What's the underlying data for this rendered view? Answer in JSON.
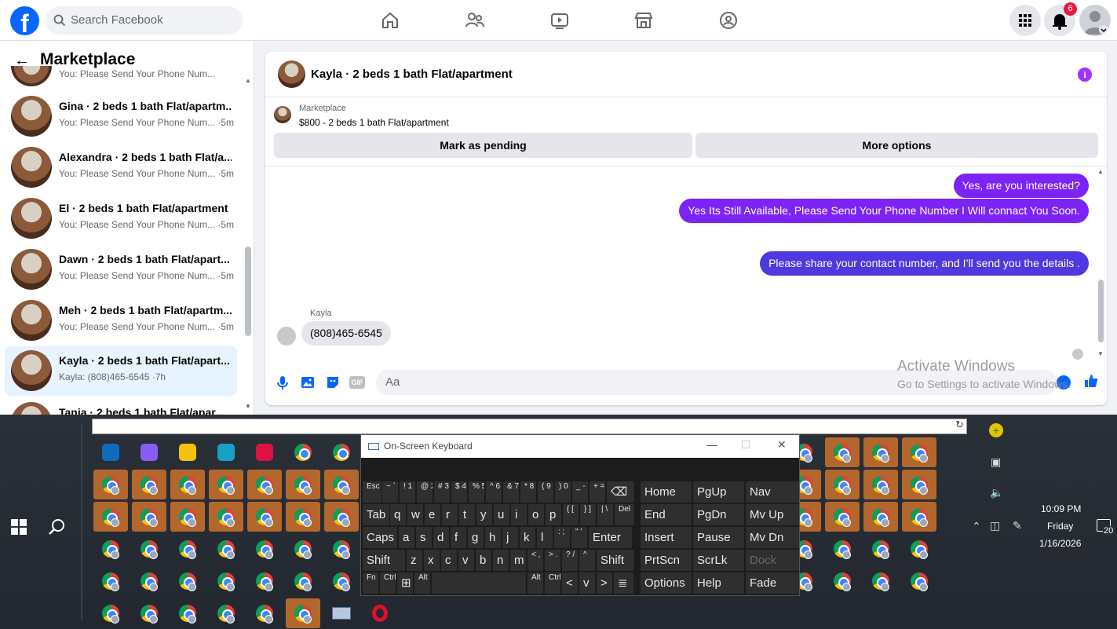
{
  "topnav": {
    "logo": "f",
    "search_placeholder": "Search Facebook",
    "notification_count": "6"
  },
  "sidebar": {
    "title": "Marketplace",
    "partial_top_text": "You: Please Send Your Phone Num...",
    "conversations": [
      {
        "title": "Gina · 2 beds 1 bath Flat/apartm...",
        "preview": "You: Please Send Your Phone Num... ·5m"
      },
      {
        "title": "Alexandra · 2 beds 1 bath Flat/a...",
        "preview": "You: Please Send Your Phone Num... ·5m"
      },
      {
        "title": "El · 2 beds 1 bath Flat/apartment",
        "preview": "You: Please Send Your Phone Num... ·5m"
      },
      {
        "title": "Dawn · 2 beds 1 bath Flat/apart...",
        "preview": "You: Please Send Your Phone Num... ·5m"
      },
      {
        "title": "Meh · 2 beds 1 bath Flat/apartm...",
        "preview": "You: Please Send Your Phone Num... ·5m"
      },
      {
        "title": "Kayla · 2 beds 1 bath Flat/apart...",
        "preview": "Kayla: (808)465-6545 ·7h"
      },
      {
        "title": "Tania · 2 beds 1 bath Flat/apar...",
        "preview": ""
      }
    ]
  },
  "chat": {
    "header_title": "Kayla · 2 beds 1 bath Flat/apartment",
    "marketplace_label": "Marketplace",
    "listing": "$800 - 2 beds 1 bath Flat/apartment",
    "mark_pending": "Mark as pending",
    "more_options": "More options",
    "messages_out": [
      "Yes, are you interested?",
      "Yes Its Still Available, Please Send Your Phone Number I Will connact You Soon.",
      "Please share your contact number, and I’ll send you the details ."
    ],
    "sender_name": "Kayla",
    "message_in": "(808)465-6545",
    "composer_placeholder": "Aa",
    "gif_label": "GIF"
  },
  "watermark": {
    "line1": "Activate Windows",
    "line2": "Go to Settings to activate Windows."
  },
  "osk": {
    "title": "On-Screen Keyboard",
    "row1": [
      "Esc",
      "~ `",
      "! 1",
      "@ 2",
      "# 3",
      "$ 4",
      "% 5",
      "^ 6",
      "& 7",
      "* 8",
      "( 9",
      ") 0",
      "_ -",
      "+ =",
      "⌫",
      "Home",
      "PgUp",
      "Nav"
    ],
    "row2": [
      "Tab",
      "q",
      "w",
      "e",
      "r",
      "t",
      "y",
      "u",
      "i",
      "o",
      "p",
      "{ [",
      "} ]",
      "| \\",
      "Del",
      "End",
      "PgDn",
      "Mv Up"
    ],
    "row3": [
      "Caps",
      "a",
      "s",
      "d",
      "f",
      "g",
      "h",
      "j",
      "k",
      "l",
      ": ;",
      "\" '",
      "Enter",
      "Insert",
      "Pause",
      "Mv Dn"
    ],
    "row4": [
      "Shift",
      "z",
      "x",
      "c",
      "v",
      "b",
      "n",
      "m",
      "< ,",
      "> .",
      "? /",
      "^",
      "Shift",
      "PrtScn",
      "ScrLk",
      "Dock"
    ],
    "row5": [
      "Fn",
      "Ctrl",
      "⊞",
      "Alt",
      "",
      "Alt",
      "Ctrl",
      "<",
      "v",
      ">",
      "≣",
      "Options",
      "Help",
      "Fade"
    ]
  },
  "tray": {
    "time": "10:09 PM",
    "day": "Friday",
    "date": "1/16/2026",
    "notif_count": "20"
  },
  "colors": {
    "fb_blue": "#0866ff",
    "bubble_purple": "#7c24f5",
    "badge_red": "#e41e3f",
    "taskbar_highlight": "#b4672d"
  }
}
